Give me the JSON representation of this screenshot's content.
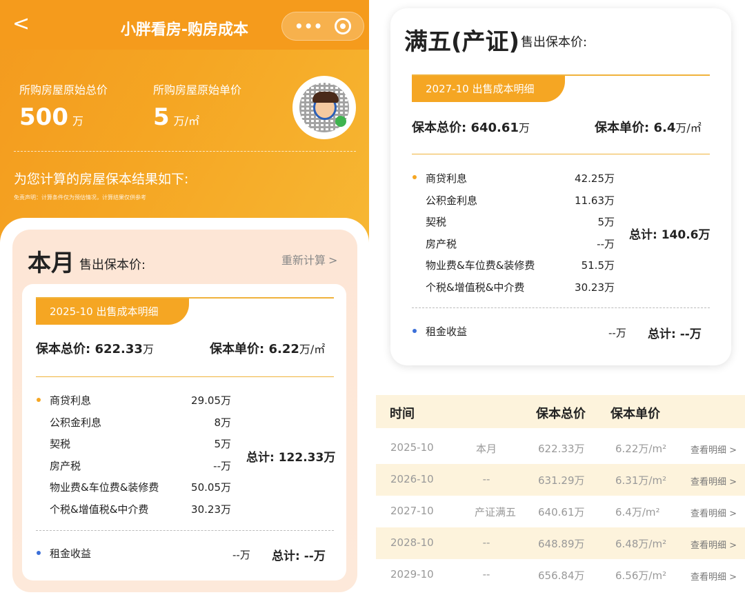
{
  "navbar": {
    "back_glyph": "<",
    "title": "小胖看房-购房成本",
    "menu_glyph": "•••"
  },
  "summary": {
    "total_label": "所购房屋原始总价",
    "total_value": "500",
    "total_unit": "万",
    "unit_label": "所购房屋原始单价",
    "unit_value": "5",
    "unit_unit": "万/㎡",
    "result_title": "为您计算的房屋保本结果如下:",
    "disclaimer": "免责声明：计算条件仅为预估情况，计算结果仅供参考"
  },
  "month_card": {
    "title": "本月",
    "subtitle": "售出保本价:",
    "recalc_label": "重新计算",
    "recalc_chevron": ">",
    "detail_tab": "2025-10 出售成本明细",
    "total_price_label": "保本总价:",
    "total_price_value": "622.33",
    "total_price_unit": "万",
    "unit_price_label": "保本单价:",
    "unit_price_value": "6.22",
    "unit_price_unit": "万/㎡",
    "costs": [
      {
        "label": "商贷利息",
        "amount": "29.05万"
      },
      {
        "label": "公积金利息",
        "amount": "8万"
      },
      {
        "label": "契税",
        "amount": "5万"
      },
      {
        "label": "房产税",
        "amount": "--万"
      },
      {
        "label": "物业费&车位费&装修费",
        "amount": "50.05万"
      },
      {
        "label": "个税&增值税&中介费",
        "amount": "30.23万"
      }
    ],
    "costs_total": "总计: 122.33万",
    "rent_label": "租金收益",
    "rent_amount": "--万",
    "rent_total": "总计: --万"
  },
  "five_year_card": {
    "title": "满五(产证)",
    "subtitle": "售出保本价:",
    "detail_tab": "2027-10 出售成本明细",
    "total_price_label": "保本总价:",
    "total_price_value": "640.61",
    "total_price_unit": "万",
    "unit_price_label": "保本单价:",
    "unit_price_value": "6.4",
    "unit_price_unit": "万/㎡",
    "costs": [
      {
        "label": "商贷利息",
        "amount": "42.25万"
      },
      {
        "label": "公积金利息",
        "amount": "11.63万"
      },
      {
        "label": "契税",
        "amount": "5万"
      },
      {
        "label": "房产税",
        "amount": "--万"
      },
      {
        "label": "物业费&车位费&装修费",
        "amount": "51.5万"
      },
      {
        "label": "个税&增值税&中介费",
        "amount": "30.23万"
      }
    ],
    "costs_total": "总计: 140.6万",
    "rent_label": "租金收益",
    "rent_amount": "--万",
    "rent_total": "总计: --万"
  },
  "table": {
    "headers": [
      "时间",
      "保本总价",
      "保本单价"
    ],
    "rows": [
      {
        "time": "2025-10",
        "note": "本月",
        "total": "622.33万",
        "unit": "6.22万/m²",
        "link": "查看明细 >"
      },
      {
        "time": "2026-10",
        "note": "--",
        "total": "631.29万",
        "unit": "6.31万/m²",
        "link": "查看明细 >"
      },
      {
        "time": "2027-10",
        "note": "产证满五",
        "total": "640.61万",
        "unit": "6.4万/m²",
        "link": "查看明细 >"
      },
      {
        "time": "2028-10",
        "note": "--",
        "total": "648.89万",
        "unit": "6.48万/m²",
        "link": "查看明细 >"
      },
      {
        "time": "2029-10",
        "note": "--",
        "total": "656.84万",
        "unit": "6.56万/m²",
        "link": "查看明细 >"
      }
    ]
  },
  "colors": {
    "brand_orange": "#f5a623",
    "accent_line": "#f0b23a",
    "peach": "#fde6d6",
    "table_alt": "#fdf3dc",
    "bullet_orange": "#f5a623",
    "bullet_blue": "#3b6fd8"
  }
}
